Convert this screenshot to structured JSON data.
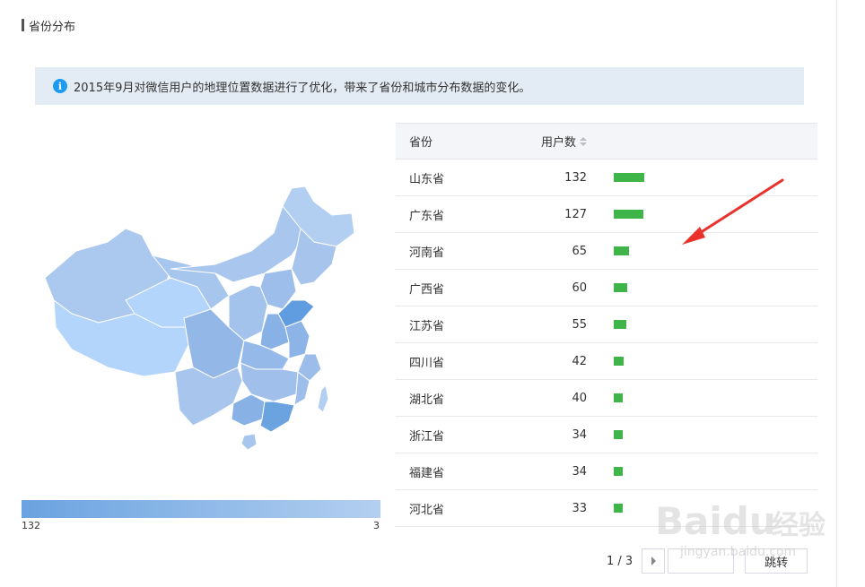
{
  "section": {
    "title": "省份分布"
  },
  "notice": {
    "text": "2015年9月对微信用户的地理位置数据进行了优化，带来了省份和城市分布数据的变化。"
  },
  "legend": {
    "min_label": "132",
    "max_label": "3",
    "color_high": "#6aa3e0",
    "color_low": "#b3cff0"
  },
  "table": {
    "headers": {
      "province": "省份",
      "users": "用户数"
    },
    "max_value": 132,
    "bar_color": "#3fb449",
    "rows": [
      {
        "province": "山东省",
        "users": "132",
        "value": 132
      },
      {
        "province": "广东省",
        "users": "127",
        "value": 127
      },
      {
        "province": "河南省",
        "users": "65",
        "value": 65
      },
      {
        "province": "广西省",
        "users": "60",
        "value": 60
      },
      {
        "province": "江苏省",
        "users": "55",
        "value": 55
      },
      {
        "province": "四川省",
        "users": "42",
        "value": 42
      },
      {
        "province": "湖北省",
        "users": "40",
        "value": 40
      },
      {
        "province": "浙江省",
        "users": "34",
        "value": 34
      },
      {
        "province": "福建省",
        "users": "34",
        "value": 34
      },
      {
        "province": "河北省",
        "users": "33",
        "value": 33
      }
    ]
  },
  "pager": {
    "info": "1 / 3",
    "jump_label": "跳转"
  },
  "watermark": {
    "brand": "Baidu",
    "cn": "经验",
    "url": "jingyan.baidu.com"
  }
}
